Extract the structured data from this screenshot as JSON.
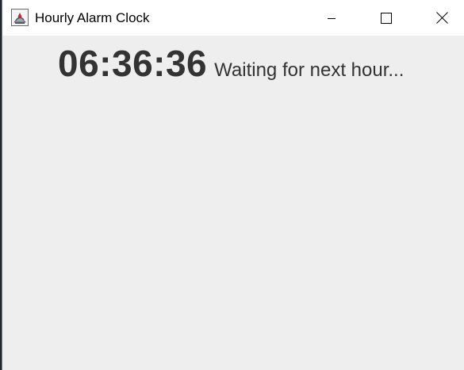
{
  "window": {
    "title": "Hourly Alarm Clock",
    "app_icon": "java-cup-icon",
    "controls": {
      "minimize_icon": "minimize-icon",
      "maximize_icon": "maximize-icon",
      "close_icon": "close-icon"
    }
  },
  "clock": {
    "time": "06:36:36",
    "status": "Waiting for next hour..."
  },
  "colors": {
    "titlebar_bg": "#ffffff",
    "content_bg": "#eeeeee",
    "text": "#333333"
  }
}
